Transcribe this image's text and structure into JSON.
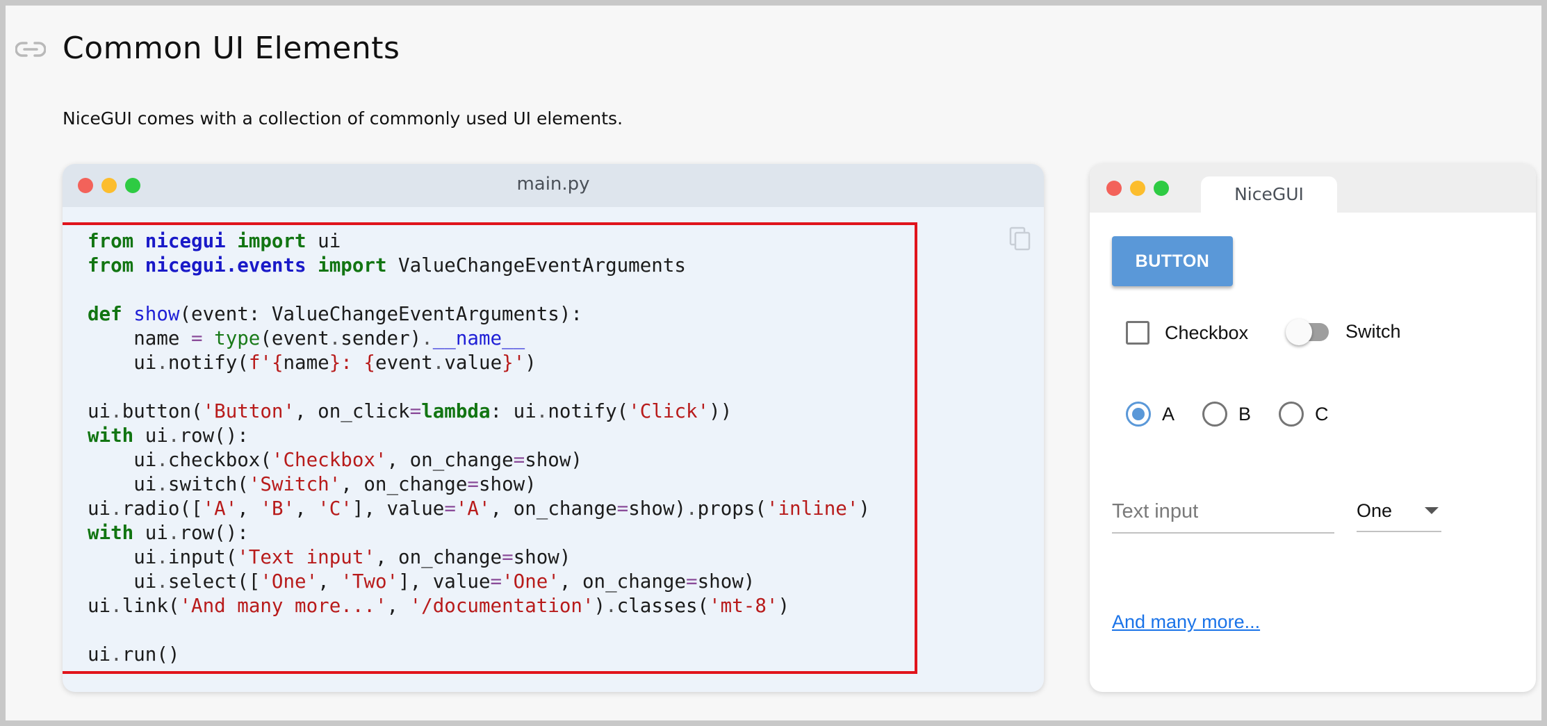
{
  "section": {
    "title": "Common UI Elements",
    "intro": "NiceGUI comes with a collection of commonly used UI elements."
  },
  "code_window": {
    "filename": "main.py",
    "lines": [
      "from nicegui import ui",
      "from nicegui.events import ValueChangeEventArguments",
      "",
      "def show(event: ValueChangeEventArguments):",
      "    name = type(event.sender).__name__",
      "    ui.notify(f'{name}: {event.value}')",
      "",
      "ui.button('Button', on_click=lambda: ui.notify('Click'))",
      "with ui.row():",
      "    ui.checkbox('Checkbox', on_change=show)",
      "    ui.switch('Switch', on_change=show)",
      "ui.radio(['A', 'B', 'C'], value='A', on_change=show).props('inline')",
      "with ui.row():",
      "    ui.input('Text input', on_change=show)",
      "    ui.select(['One', 'Two'], value='One', on_change=show)",
      "ui.link('And many more...', '/documentation').classes('mt-8')",
      "",
      "ui.run()"
    ]
  },
  "preview_window": {
    "tab_title": "NiceGUI",
    "button_label": "BUTTON",
    "checkbox_label": "Checkbox",
    "checkbox_checked": false,
    "switch_label": "Switch",
    "switch_on": false,
    "radio": {
      "options": [
        "A",
        "B",
        "C"
      ],
      "selected": "A"
    },
    "text_input_placeholder": "Text input",
    "select_value": "One",
    "link_text": "And many more..."
  },
  "colors": {
    "accent": "#5a98d8",
    "highlight_border": "#e0141c",
    "link": "#1a73e8"
  }
}
